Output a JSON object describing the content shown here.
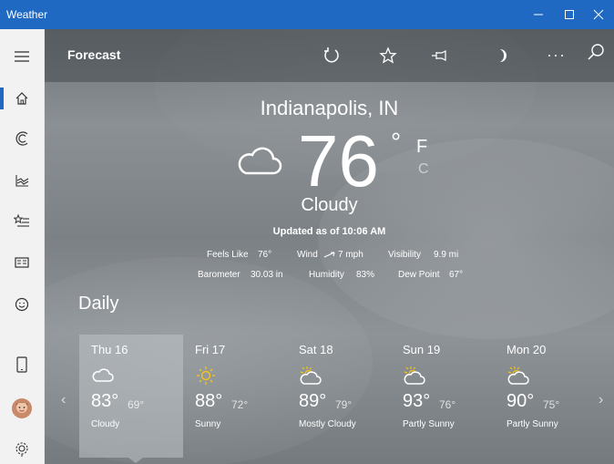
{
  "window": {
    "title": "Weather",
    "accent_color": "#1f69c2",
    "controls": [
      "minimize-icon",
      "maximize-icon",
      "close-icon"
    ]
  },
  "sidebar": {
    "items": [
      {
        "name": "hamburger-menu",
        "icon": "hamburger-icon"
      },
      {
        "name": "forecast",
        "icon": "home-icon",
        "active": true
      },
      {
        "name": "maps",
        "icon": "radar-icon"
      },
      {
        "name": "historical-weather",
        "icon": "chart-icon"
      },
      {
        "name": "places",
        "icon": "star-list-icon"
      },
      {
        "name": "news",
        "icon": "news-icon"
      },
      {
        "name": "feedback",
        "icon": "smiley-icon"
      },
      {
        "name": "device",
        "icon": "phone-icon"
      },
      {
        "name": "account",
        "icon": "avatar"
      },
      {
        "name": "settings",
        "icon": "gear-icon"
      }
    ]
  },
  "commandbar": {
    "title": "Forecast",
    "buttons": [
      "refresh-icon",
      "favorite-star-icon",
      "pin-icon",
      "moon-icon",
      "more-icon",
      "search-icon"
    ]
  },
  "current": {
    "location": "Indianapolis, IN",
    "temperature": "76",
    "degree_symbol": "°",
    "unit_f": "F",
    "unit_c": "C",
    "condition": "Cloudy",
    "updated": "Updated as of 10:06 AM",
    "details": {
      "feels_like_label": "Feels Like",
      "feels_like": "76°",
      "wind_label": "Wind",
      "wind": "7 mph",
      "visibility_label": "Visibility",
      "visibility": "9.9 mi",
      "barometer_label": "Barometer",
      "barometer": "30.03 in",
      "humidity_label": "Humidity",
      "humidity": "83%",
      "dew_point_label": "Dew Point",
      "dew_point": "67°"
    }
  },
  "daily": {
    "heading": "Daily",
    "days": [
      {
        "day": "Thu 16",
        "icon": "cloud-icon",
        "high": "83°",
        "low": "69°",
        "condition": "Cloudy",
        "selected": true
      },
      {
        "day": "Fri 17",
        "icon": "sun-icon",
        "high": "88°",
        "low": "72°",
        "condition": "Sunny"
      },
      {
        "day": "Sat 18",
        "icon": "partly-sunny-icon",
        "high": "89°",
        "low": "79°",
        "condition": "Mostly Cloudy"
      },
      {
        "day": "Sun 19",
        "icon": "partly-sunny-icon",
        "high": "93°",
        "low": "76°",
        "condition": "Partly Sunny"
      },
      {
        "day": "Mon 20",
        "icon": "partly-sunny-icon",
        "high": "90°",
        "low": "75°",
        "condition": "Partly Sunny"
      }
    ],
    "prev_arrow": "‹",
    "next_arrow": "›"
  }
}
